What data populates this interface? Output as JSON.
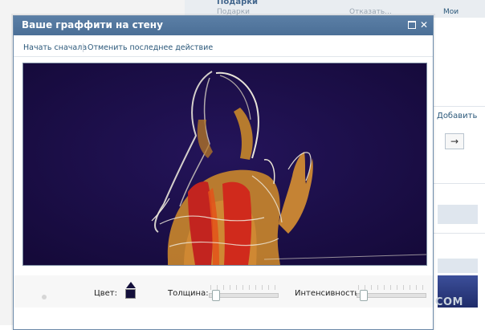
{
  "window": {
    "title": "Ваше граффити на стену"
  },
  "toolbar": {
    "start_over": "Начать сначала",
    "undo_last": "Отменить последнее действие"
  },
  "controls": {
    "color_label": "Цвет:",
    "color_value": "#14103b",
    "thickness_label": "Толщина:",
    "thickness_level": 0.05,
    "intensity_label": "Интенсивность:",
    "intensity_level": 0.05
  },
  "background_page": {
    "top_heading": "Подарки",
    "top_text_left": "Подарки",
    "top_text_mid": "Отказать...",
    "top_text_right": "Мои подарки",
    "add_link": "Добавить",
    "arrow_button": "→"
  },
  "watermark": "YAPLAKAL.COM",
  "colors": {
    "header": "#4b6f96",
    "link": "#2b587a",
    "canvas_bg": "#1b0f46"
  }
}
